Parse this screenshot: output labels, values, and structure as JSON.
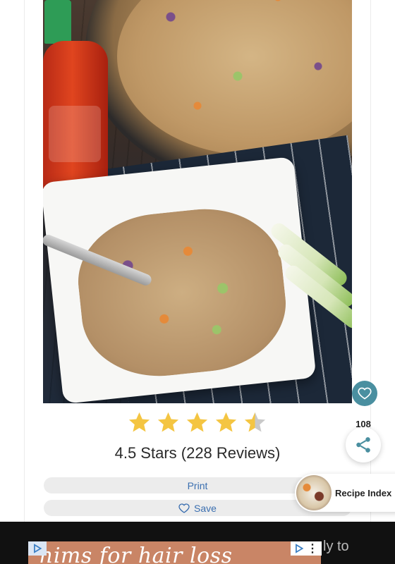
{
  "recipe": {
    "rating": {
      "stars_value": 4.5,
      "stars_max": 5,
      "text": "4.5 Stars (228 Reviews)"
    },
    "actions": {
      "print_label": "Print",
      "save_label": "Save"
    }
  },
  "floating": {
    "share_count": "108",
    "recipe_index_label": "Recipe Index"
  },
  "ad": {
    "banner_text": "hims for hair loss",
    "trailing_text": "ly to"
  },
  "colors": {
    "star_filled": "#f4c542",
    "star_empty": "#c9c9c9",
    "link_blue": "#3b6fb0",
    "fab_teal": "#4a8fa0"
  },
  "icons": {
    "heart": "heart-icon",
    "share": "share-icon",
    "save": "heart-outline-icon",
    "ad_choices": "adchoices-icon",
    "more": "more-vertical-icon"
  }
}
